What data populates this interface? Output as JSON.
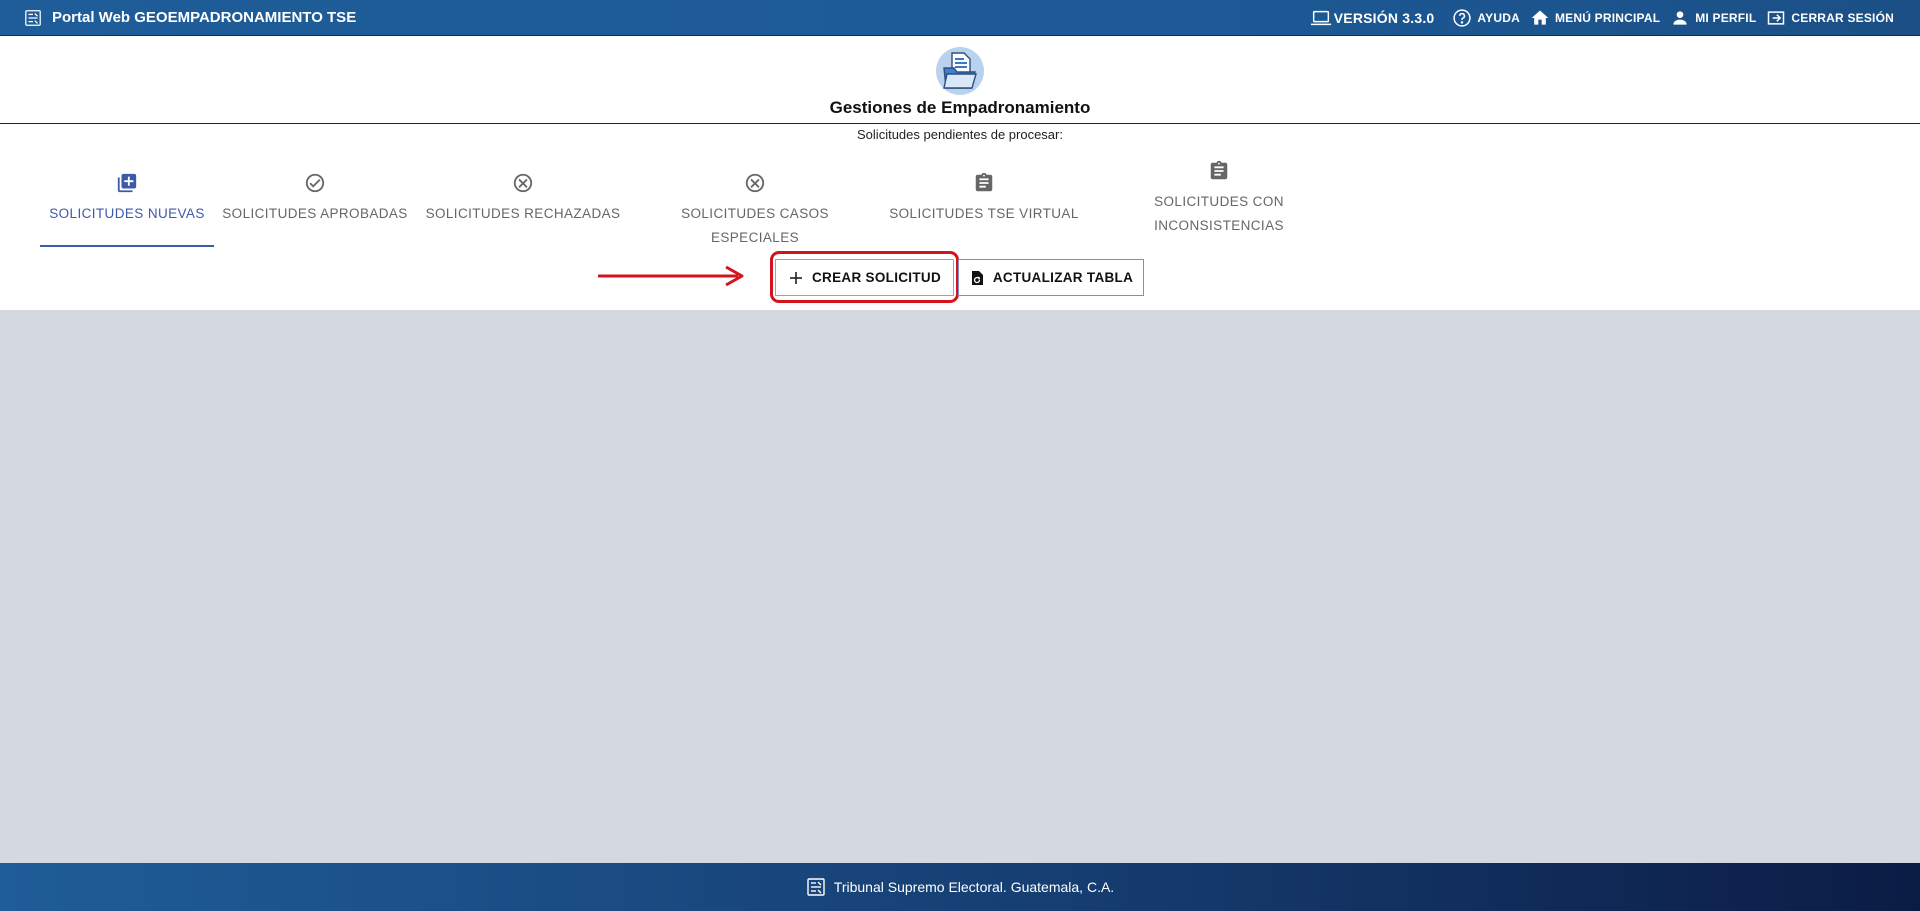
{
  "header": {
    "title": "Portal Web GEOEMPADRONAMIENTO TSE",
    "version": "VERSIÓN 3.3.0",
    "nav": {
      "help": "AYUDA",
      "main_menu": "MENÚ PRINCIPAL",
      "profile": "MI PERFIL",
      "logout": "CERRAR SESIÓN"
    }
  },
  "page": {
    "title": "Gestiones de Empadronamiento",
    "subtitle": "Solicitudes pendientes de procesar:"
  },
  "tabs": [
    {
      "label": "SOLICITUDES NUEVAS",
      "icon": "add-box-icon",
      "active": true
    },
    {
      "label": "SOLICITUDES APROBADAS",
      "icon": "check-circle-icon",
      "active": false
    },
    {
      "label": "SOLICITUDES RECHAZADAS",
      "icon": "cancel-circle-icon",
      "active": false
    },
    {
      "label": "SOLICITUDES CASOS ESPECIALES",
      "icon": "cancel-circle-icon",
      "active": false
    },
    {
      "label": "SOLICITUDES TSE VIRTUAL",
      "icon": "clipboard-icon",
      "active": false
    },
    {
      "label_line1": "SOLICITUDES CON",
      "label_line2": "INCONSISTENCIAS",
      "icon": "clipboard-icon",
      "active": false
    }
  ],
  "actions": {
    "create": "CREAR SOLICITUD",
    "refresh": "ACTUALIZAR TABLA"
  },
  "footer": {
    "text": "Tribunal Supremo Electoral. Guatemala, C.A."
  },
  "colors": {
    "header_bg": "#1e5d99",
    "active_tab": "#3c5aa8",
    "highlight": "#d3141c",
    "page_bg": "#d4d8e1"
  }
}
